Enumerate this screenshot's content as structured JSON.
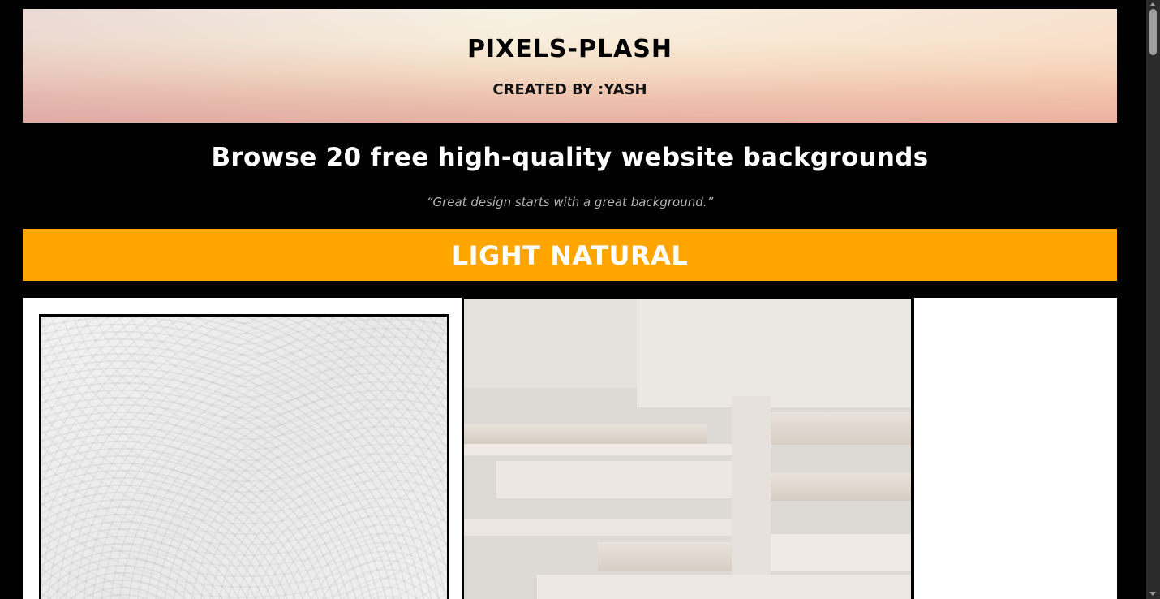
{
  "header": {
    "title": "PIXELS-PLASH",
    "credit": "CREATED BY :YASH"
  },
  "intro": {
    "headline": "Browse 20 free high-quality website backgrounds",
    "quote": "“Great design starts with a great background.”"
  },
  "category": {
    "label": "LIGHT NATURAL",
    "color": "#ffa500"
  },
  "gallery": {
    "items": [
      {
        "name": "white-plaster-texture"
      },
      {
        "name": "beige-geometric-shelves"
      }
    ]
  },
  "colors": {
    "background": "#000000",
    "accent": "#ffa500",
    "text_light": "#ffffff",
    "quote_text": "#b7b7b7"
  }
}
